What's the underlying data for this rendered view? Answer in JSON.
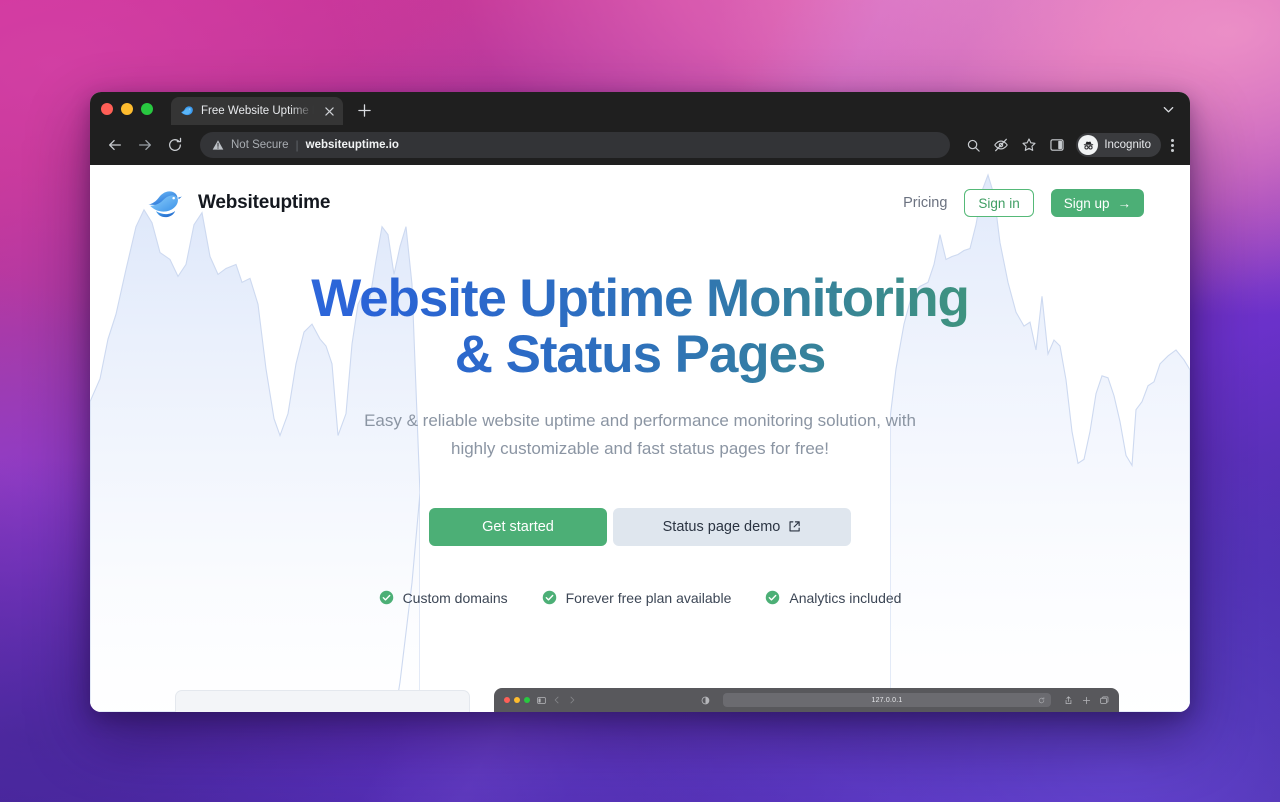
{
  "browser": {
    "traffic_lights": [
      "close",
      "minimize",
      "zoom"
    ],
    "tab": {
      "title": "Free Website Uptime Monitorin",
      "favicon": "bird-favicon",
      "close_icon": "close-icon"
    },
    "new_tab_label": "+",
    "tab_list_icon": "chevron-down-icon",
    "toolbar": {
      "back_icon": "back-arrow-icon",
      "forward_icon": "forward-arrow-icon",
      "reload_icon": "reload-icon",
      "security_warning_icon": "warning-triangle-icon",
      "security_text": "Not Secure",
      "separator": "|",
      "url": "websiteuptime.io",
      "zoom_icon": "magnifier-icon",
      "tracking_icon": "eye-slash-icon",
      "bookmark_icon": "star-icon",
      "side_panel_icon": "side-panel-icon",
      "profile_icon": "incognito-avatar-icon",
      "profile_label": "Incognito",
      "menu_icon": "kebab-menu-icon"
    }
  },
  "site": {
    "brand": {
      "logo": "blue-bird-logo",
      "name": "Websiteuptime"
    },
    "nav": {
      "pricing_label": "Pricing",
      "signin_label": "Sign in",
      "signup_label": "Sign up",
      "signup_arrow": "→"
    },
    "hero": {
      "headline_line1": "Website Uptime Monitoring",
      "headline_line2": "& Status Pages",
      "subtitle": "Easy & reliable website uptime and performance monitoring solution, with highly customizable and fast status pages for free!",
      "cta_primary": "Get started",
      "cta_secondary": "Status page demo",
      "cta_secondary_icon": "external-link-icon",
      "features": [
        {
          "icon": "check-circle-icon",
          "label": "Custom domains"
        },
        {
          "icon": "check-circle-icon",
          "label": "Forever free plan available"
        },
        {
          "icon": "check-circle-icon",
          "label": "Analytics included"
        }
      ]
    },
    "mockup": {
      "safari_address": "127.0.0.1",
      "sidebar_icon": "sidebar-toggle-icon",
      "back_icon": "chevron-left-icon",
      "forward_icon": "chevron-right-icon",
      "reader_icon": "reader-contrast-icon",
      "reload_icon": "reload-icon",
      "share_icon": "share-icon",
      "newtab_icon": "plus-icon",
      "tabs_icon": "tab-overview-icon"
    }
  },
  "colors": {
    "brand_green": "#4caf76",
    "signin_green": "#3f9e63",
    "headline_gradient_start": "#3b74e8",
    "headline_gradient_end": "#4bab60",
    "subtitle_gray": "#8b95a3",
    "cta_secondary_bg": "#dfe6ee",
    "chart_fill": "#e8eefb",
    "browser_chrome": "#1f1f1f"
  },
  "chart_data": {
    "type": "area",
    "title": "",
    "note": "decorative background uptime area charts",
    "series": [
      {
        "name": "left-chart",
        "x": [
          0,
          4,
          8,
          12,
          16,
          20,
          24,
          28,
          32,
          36,
          40,
          44,
          48,
          52,
          56,
          60,
          64,
          68,
          72,
          76,
          80,
          84,
          88,
          92,
          96,
          100
        ],
        "values": [
          46,
          62,
          78,
          70,
          66,
          64,
          72,
          58,
          80,
          62,
          56,
          68,
          64,
          30,
          24,
          44,
          52,
          42,
          20,
          58,
          70,
          64,
          84,
          72,
          30,
          4
        ]
      },
      {
        "name": "right-chart",
        "x": [
          0,
          5,
          10,
          15,
          20,
          25,
          30,
          35,
          40,
          45,
          50,
          55,
          60,
          65,
          70,
          75,
          80,
          85,
          90,
          95,
          100
        ],
        "values": [
          56,
          64,
          72,
          76,
          70,
          74,
          96,
          86,
          64,
          60,
          44,
          70,
          40,
          36,
          20,
          18,
          42,
          50,
          34,
          16,
          44
        ]
      }
    ],
    "xlabel": "",
    "ylabel": "",
    "ylim": [
      0,
      100
    ],
    "grid": false,
    "legend": false
  }
}
